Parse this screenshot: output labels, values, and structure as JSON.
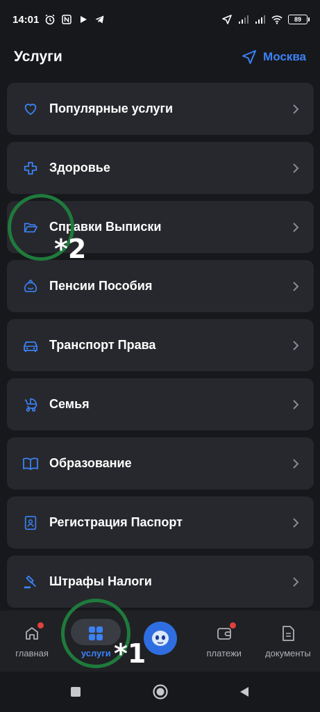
{
  "status_bar": {
    "time": "14:01",
    "battery": "89",
    "icons": [
      "alarm-icon",
      "nfc-icon",
      "play-icon",
      "telegram-icon",
      "location-arrow-icon",
      "signal-icon",
      "signal-icon",
      "wifi-icon",
      "battery-icon"
    ]
  },
  "header": {
    "title": "Услуги",
    "city": "Москва",
    "city_icon": "location-arrow-icon"
  },
  "services": [
    {
      "label": "Популярные услуги",
      "icon": "heart-icon"
    },
    {
      "label": "Здоровье",
      "icon": "medical-cross-icon"
    },
    {
      "label": "Справки Выписки",
      "icon": "folder-icon"
    },
    {
      "label": "Пенсии Пособия",
      "icon": "piggy-bank-icon"
    },
    {
      "label": "Транспорт Права",
      "icon": "car-icon"
    },
    {
      "label": "Семья",
      "icon": "stroller-icon"
    },
    {
      "label": "Образование",
      "icon": "book-icon"
    },
    {
      "label": "Регистрация Паспорт",
      "icon": "passport-icon"
    },
    {
      "label": "Штрафы Налоги",
      "icon": "gavel-icon"
    }
  ],
  "annotations": {
    "label_1": "*1",
    "label_2": "*2",
    "color": "#1f7a3c"
  },
  "bottom_nav": {
    "items": [
      {
        "label": "главная",
        "icon": "home-icon",
        "badge": true
      },
      {
        "label": "услуги",
        "icon": "grid-icon",
        "active": true
      },
      {
        "label": "",
        "icon": "assistant-robot-icon"
      },
      {
        "label": "платежи",
        "icon": "wallet-icon",
        "badge": true
      },
      {
        "label": "документы",
        "icon": "document-icon"
      }
    ]
  },
  "colors": {
    "background": "#17181c",
    "card": "#27282d",
    "accent": "#3b82f6",
    "badge": "#e0413b"
  }
}
